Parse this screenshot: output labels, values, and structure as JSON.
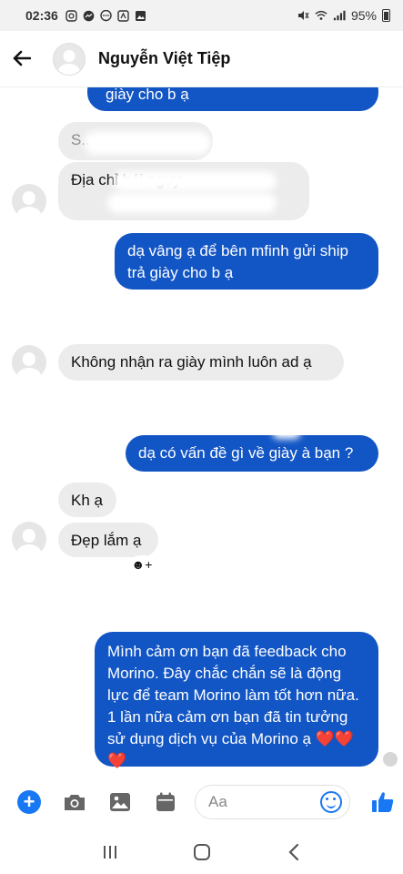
{
  "status": {
    "time": "02:36",
    "battery": "95%"
  },
  "header": {
    "contact_name": "Nguyễn Việt Tiệp"
  },
  "messages": [
    {
      "dir": "out",
      "text": "giày cho b ạ"
    },
    {
      "dir": "in",
      "text": "S..."
    },
    {
      "dir": "in",
      "text": "Địa chỉ                              hái nguy"
    },
    {
      "dir": "out",
      "text": "dạ vâng ạ để bên mfinh gửi ship trả giày cho b ạ"
    },
    {
      "dir": "in",
      "text": "Không nhận ra giày mình luôn ad ạ"
    },
    {
      "dir": "out",
      "text": "dạ có vấn đề gì về giày à bạn ?"
    },
    {
      "dir": "in",
      "text": "Kh ạ"
    },
    {
      "dir": "in",
      "text": "Đẹp lắm ạ"
    },
    {
      "dir": "out",
      "text": "Mình cảm ơn bạn đã feedback cho Morino. Đây chắc chắn sẽ là động lực để team Morino làm tốt hơn nữa. 1 lần nữa cảm ơn bạn đã tin tưởng sử dụng dịch vụ của Morino ạ ❤️❤️❤️"
    }
  ],
  "reaction": {
    "label": "☻+"
  },
  "composer": {
    "placeholder": "Aa"
  },
  "colors": {
    "outgoing": "#1255c4",
    "incoming": "#ececec",
    "accent": "#1877f2"
  }
}
